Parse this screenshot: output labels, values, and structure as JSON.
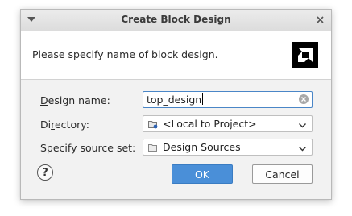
{
  "window": {
    "title": "Create Block Design",
    "menu_icon": "chevron-down-icon",
    "close_icon": "close-icon"
  },
  "header": {
    "message": "Please specify name of block design.",
    "logo": "amd-logo"
  },
  "form": {
    "design_name": {
      "label_mnemonic": "D",
      "label_rest": "esign name:",
      "value": "top_design"
    },
    "directory": {
      "label_prefix": "Di",
      "label_mnemonic": "r",
      "label_rest": "ectory:",
      "value": "<Local to Project>",
      "icon": "local-folder-icon"
    },
    "source_set": {
      "label": "Specify source set:",
      "value": "Design Sources",
      "icon": "folder-icon"
    }
  },
  "buttons": {
    "help": "?",
    "ok": "OK",
    "cancel": "Cancel"
  },
  "colors": {
    "ok_button": "#4a8fd8",
    "focus_border": "#4a86c7"
  }
}
